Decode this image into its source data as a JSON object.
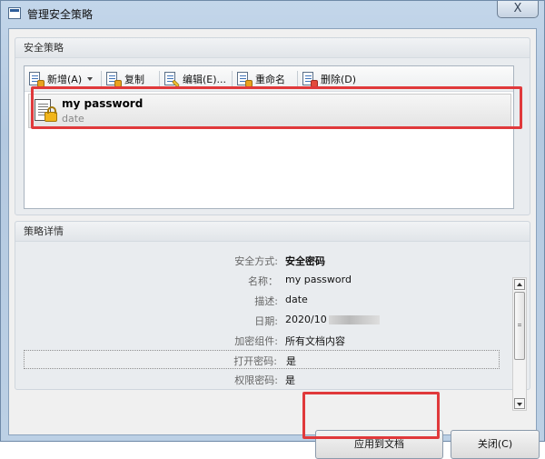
{
  "window": {
    "title": "管理安全策略",
    "close_glyph": "X"
  },
  "policies": {
    "group_title": "安全策略",
    "toolbar": {
      "add_label": "新增(A)",
      "copy_label": "复制",
      "edit_label": "编辑(E)...",
      "rename_label": "重命名",
      "delete_label": "删除(D)"
    },
    "items": [
      {
        "name": "my password",
        "description": "date"
      }
    ]
  },
  "details": {
    "group_title": "策略详情",
    "rows": [
      {
        "key": "安全方式:",
        "value": "安全密码"
      },
      {
        "key": "名称：",
        "value": "my password"
      },
      {
        "key": "描述:",
        "value": "date"
      },
      {
        "key": "日期:",
        "value": "2020/10"
      },
      {
        "key": "加密组件:",
        "value": "所有文档内容"
      },
      {
        "key": "打开密码:",
        "value": "是"
      },
      {
        "key": "权限密码:",
        "value": "是"
      }
    ]
  },
  "buttons": {
    "apply_label": "应用到文档",
    "close_label": "关闭(C)"
  },
  "colors": {
    "highlight": "#e0393b",
    "title_bar": "#c3d6ea"
  }
}
